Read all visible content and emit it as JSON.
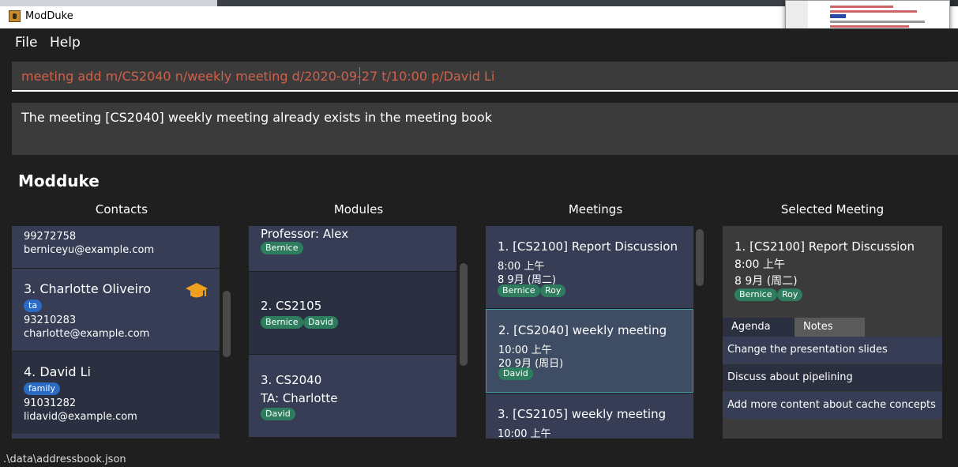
{
  "window": {
    "title": "ModDuke"
  },
  "menu": {
    "file": "File",
    "help": "Help"
  },
  "command": {
    "value": "meeting add m/CS2040 n/weekly meeting d/2020-09-27 t/10:00 p/David Li"
  },
  "result": {
    "text": "The meeting [CS2040] weekly meeting already exists in the meeting book"
  },
  "app_heading": "Modduke",
  "columns": {
    "contacts": "Contacts",
    "modules": "Modules",
    "meetings": "Meetings",
    "selected": "Selected Meeting"
  },
  "contacts": [
    {
      "phone": "99272758",
      "email": "berniceyu@example.com"
    },
    {
      "name": "3.  Charlotte Oliveiro",
      "tags": [
        "ta"
      ],
      "phone": "93210283",
      "email": "charlotte@example.com",
      "icon": "graduation-cap-icon"
    },
    {
      "name": "4.  David Li",
      "tags": [
        "family"
      ],
      "phone": "91031282",
      "email": "lidavid@example.com"
    }
  ],
  "modules": [
    {
      "role": "Professor: Alex",
      "tags": [
        "Bernice"
      ]
    },
    {
      "name": "2.  CS2105",
      "tags": [
        "Bernice",
        "David"
      ]
    },
    {
      "name": "3.  CS2040",
      "role": "TA: Charlotte",
      "tags": [
        "David"
      ]
    }
  ],
  "meetings": [
    {
      "name": "1.  [CS2100] Report Discussion",
      "time": "8:00 上午",
      "date": "8 9月 (周二)",
      "tags": [
        "Bernice",
        "Roy"
      ]
    },
    {
      "name": "2.  [CS2040] weekly meeting",
      "time": "10:00 上午",
      "date": "20 9月 (周日)",
      "tags": [
        "David"
      ]
    },
    {
      "name": "3.  [CS2105] weekly meeting",
      "time": "10:00 上午"
    }
  ],
  "selected_meeting": {
    "name": "1.  [CS2100] Report Discussion",
    "time": "8:00 上午",
    "date": "8 9月 (周二)",
    "tags": [
      "Bernice",
      "Roy"
    ],
    "tabs": [
      "Agenda",
      "Notes"
    ],
    "agenda": [
      "Change the presentation slides",
      "Discuss about pipelining",
      "Add more content about cache concepts"
    ]
  },
  "status": {
    "path": ".\\data\\addressbook.json"
  },
  "colors": {
    "command_text": "#d0604a",
    "tag_green": "#2e7d5e",
    "tag_blue": "#2a6bc4",
    "selected_border": "#3c9ea6"
  }
}
